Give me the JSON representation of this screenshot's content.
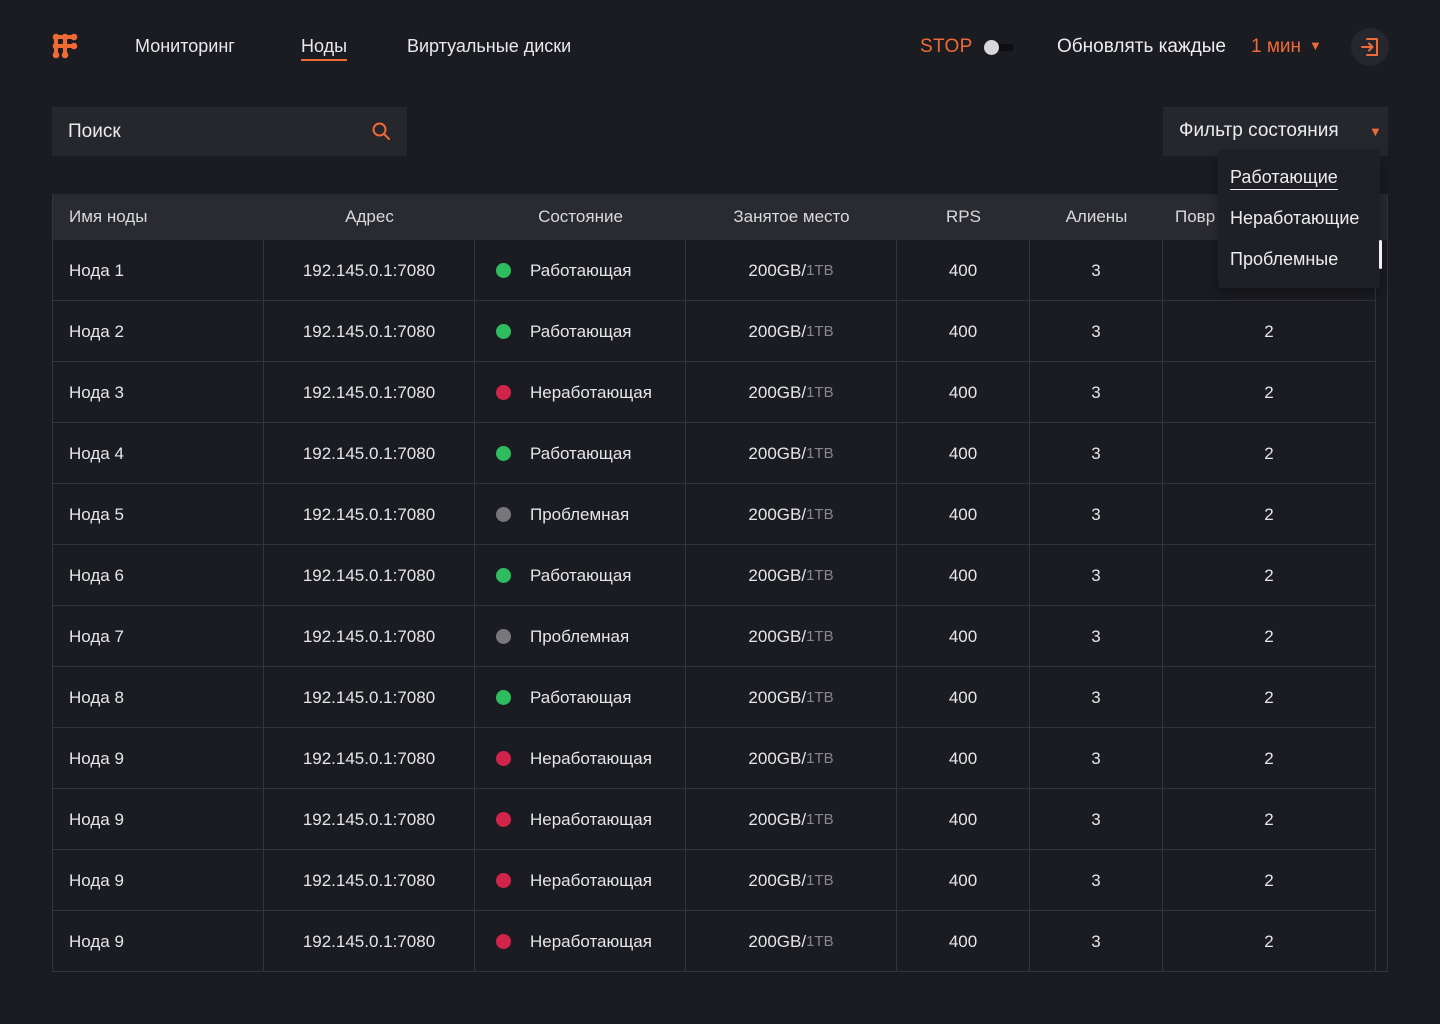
{
  "header": {
    "nav": [
      {
        "label": "Мониторинг",
        "active": false
      },
      {
        "label": "Ноды",
        "active": true
      },
      {
        "label": "Виртуальные диски",
        "active": false
      }
    ],
    "stop_label": "STOP",
    "stop_toggle_on": false,
    "refresh_label": "Обновлять каждые",
    "refresh_value": "1 мин",
    "logo_icon": "logo-icon",
    "logout_icon": "logout-icon",
    "accent_color": "#f06a35"
  },
  "search": {
    "placeholder": "Поиск",
    "value": ""
  },
  "filter": {
    "label": "Фильтр состояния",
    "options": [
      "Работающие",
      "Неработающие",
      "Проблемные"
    ],
    "selected": "Работающие"
  },
  "table": {
    "columns": [
      "Имя ноды",
      "Адрес",
      "Состояние",
      "Занятое место",
      "RPS",
      "Алиены",
      "Повр"
    ],
    "status_colors": {
      "Работающая": "#2dbd5f",
      "Неработающая": "#d1244b",
      "Проблемная": "#77777b"
    },
    "rows": [
      {
        "name": "Нода 1",
        "address": "192.145.0.1:7080",
        "status": "Работающая",
        "used": "200GB/",
        "total": "1TB",
        "rps": "400",
        "aliens": "3",
        "corrupted": ""
      },
      {
        "name": "Нода 2",
        "address": "192.145.0.1:7080",
        "status": "Работающая",
        "used": "200GB/",
        "total": "1TB",
        "rps": "400",
        "aliens": "3",
        "corrupted": "2"
      },
      {
        "name": "Нода 3",
        "address": "192.145.0.1:7080",
        "status": "Неработающая",
        "used": "200GB/",
        "total": "1TB",
        "rps": "400",
        "aliens": "3",
        "corrupted": "2"
      },
      {
        "name": "Нода 4",
        "address": "192.145.0.1:7080",
        "status": "Работающая",
        "used": "200GB/",
        "total": "1TB",
        "rps": "400",
        "aliens": "3",
        "corrupted": "2"
      },
      {
        "name": "Нода 5",
        "address": "192.145.0.1:7080",
        "status": "Проблемная",
        "used": "200GB/",
        "total": "1TB",
        "rps": "400",
        "aliens": "3",
        "corrupted": "2"
      },
      {
        "name": "Нода 6",
        "address": "192.145.0.1:7080",
        "status": "Работающая",
        "used": "200GB/",
        "total": "1TB",
        "rps": "400",
        "aliens": "3",
        "corrupted": "2"
      },
      {
        "name": "Нода 7",
        "address": "192.145.0.1:7080",
        "status": "Проблемная",
        "used": "200GB/",
        "total": "1TB",
        "rps": "400",
        "aliens": "3",
        "corrupted": "2"
      },
      {
        "name": "Нода 8",
        "address": "192.145.0.1:7080",
        "status": "Работающая",
        "used": "200GB/",
        "total": "1TB",
        "rps": "400",
        "aliens": "3",
        "corrupted": "2"
      },
      {
        "name": "Нода 9",
        "address": "192.145.0.1:7080",
        "status": "Неработающая",
        "used": "200GB/",
        "total": "1TB",
        "rps": "400",
        "aliens": "3",
        "corrupted": "2"
      },
      {
        "name": "Нода 9",
        "address": "192.145.0.1:7080",
        "status": "Неработающая",
        "used": "200GB/",
        "total": "1TB",
        "rps": "400",
        "aliens": "3",
        "corrupted": "2"
      },
      {
        "name": "Нода 9",
        "address": "192.145.0.1:7080",
        "status": "Неработающая",
        "used": "200GB/",
        "total": "1TB",
        "rps": "400",
        "aliens": "3",
        "corrupted": "2"
      },
      {
        "name": "Нода 9",
        "address": "192.145.0.1:7080",
        "status": "Неработающая",
        "used": "200GB/",
        "total": "1TB",
        "rps": "400",
        "aliens": "3",
        "corrupted": "2"
      }
    ]
  }
}
